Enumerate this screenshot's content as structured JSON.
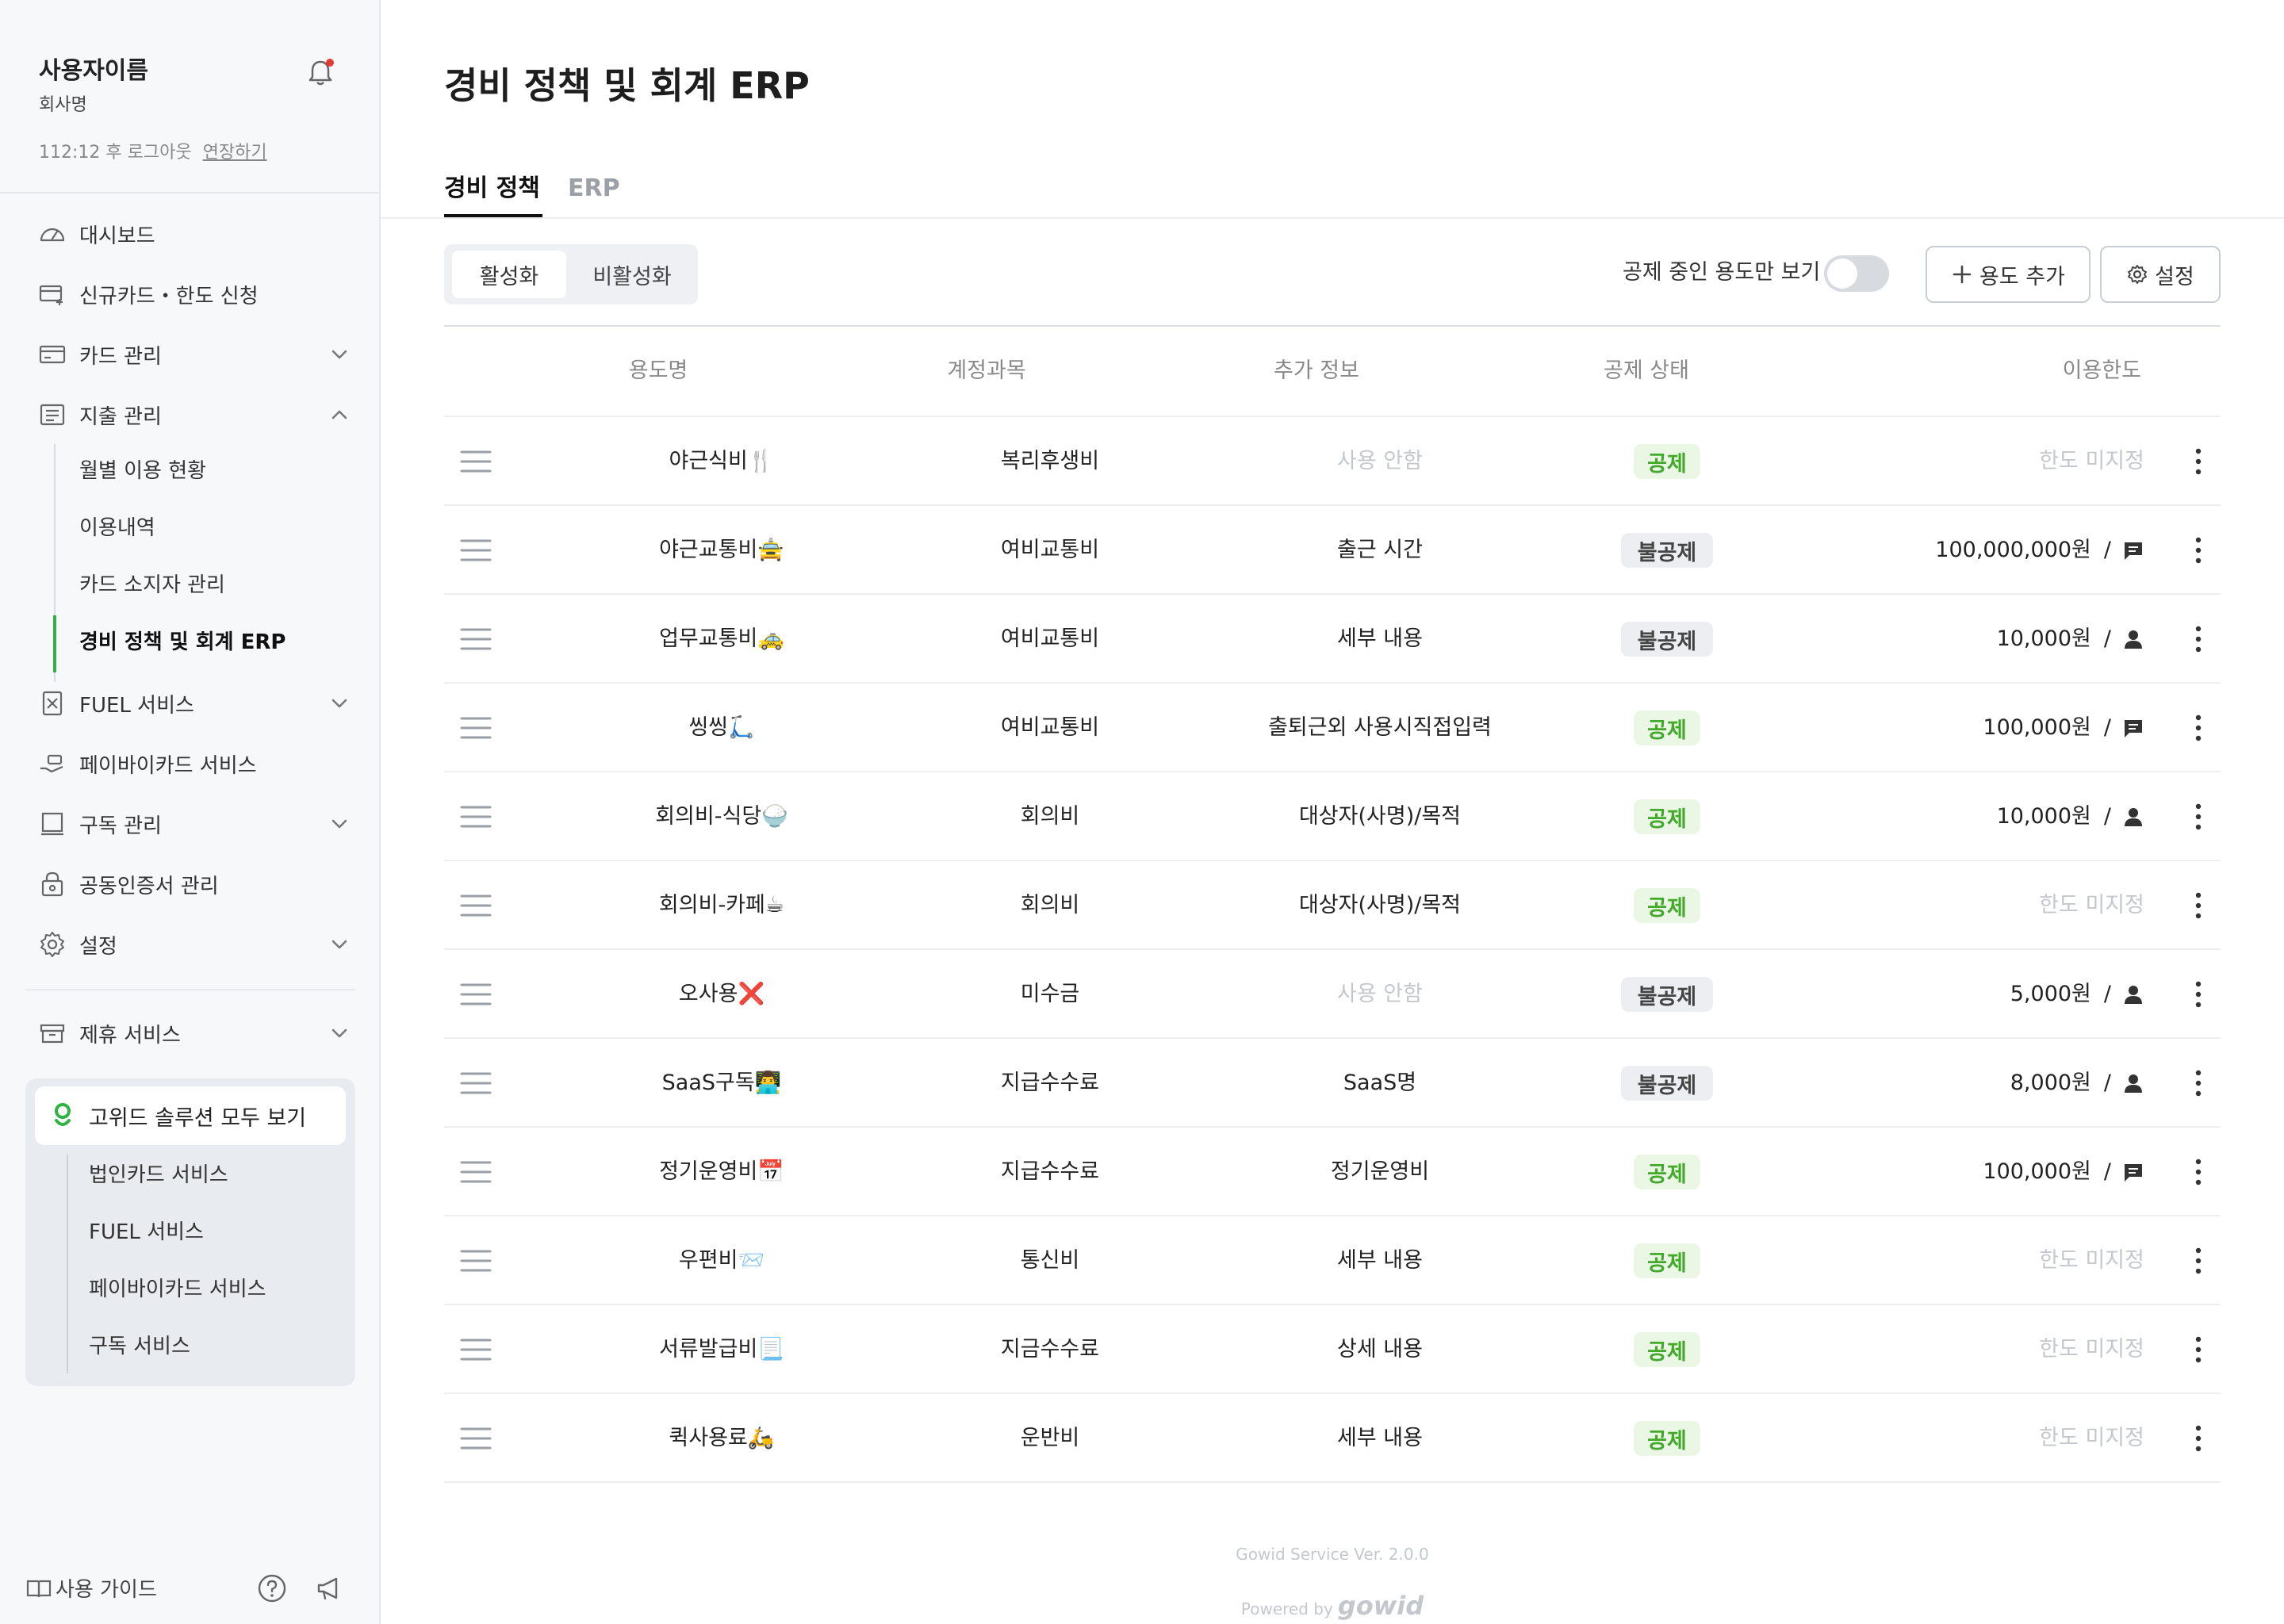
{
  "sidebar": {
    "user_name": "사용자이름",
    "company": "회사명",
    "logout_text": "112:12 후 로그아웃",
    "extend_label": "연장하기",
    "nav": [
      {
        "label": "대시보드",
        "icon": "dashboard-icon",
        "chevron": null
      },
      {
        "label": "신규카드・한도 신청",
        "icon": "card-add-icon",
        "chevron": null
      },
      {
        "label": "카드 관리",
        "icon": "card-icon",
        "chevron": "down"
      },
      {
        "label": "지출 관리",
        "icon": "receipt-icon",
        "chevron": "up"
      }
    ],
    "sub_items": [
      "월별 이용 현황",
      "이용내역",
      "카드 소지자 관리",
      "경비 정책 및 회계 ERP"
    ],
    "nav2": [
      {
        "label": "FUEL 서비스",
        "icon": "fuel-icon",
        "chevron": "down"
      },
      {
        "label": "페이바이카드 서비스",
        "icon": "hand-pay-icon",
        "chevron": null
      },
      {
        "label": "구독 관리",
        "icon": "subscription-icon",
        "chevron": "down"
      },
      {
        "label": "공동인증서 관리",
        "icon": "certificate-lock-icon",
        "chevron": null
      },
      {
        "label": "설정",
        "icon": "gear-icon",
        "chevron": "down"
      }
    ],
    "partner": {
      "label": "제휴 서비스"
    },
    "solutions_head": "고위드 솔루션 모두 보기",
    "solutions": [
      "법인카드 서비스",
      "FUEL 서비스",
      "페이바이카드 서비스",
      "구독 서비스"
    ],
    "guide_label": "사용 가이드"
  },
  "main": {
    "title": "경비 정책 및 회계 ERP",
    "tabs": [
      "경비 정책",
      "ERP"
    ],
    "segment": [
      "활성화",
      "비활성화"
    ],
    "toggle_label": "공제 중인 용도만 보기",
    "add_button": "용도 추가",
    "settings_button": "설정",
    "columns": [
      "용도명",
      "계정과목",
      "추가 정보",
      "공제 상태",
      "이용한도"
    ],
    "rows": [
      {
        "name": "야근식비🍴",
        "account": "복리후생비",
        "extra": "사용 안함",
        "extra_muted": true,
        "status": "공제",
        "deductible": true,
        "limit": "한도 미지정",
        "limit_icon": ""
      },
      {
        "name": "야근교통비🚖",
        "account": "여비교통비",
        "extra": "출근 시간",
        "extra_muted": false,
        "status": "불공제",
        "deductible": false,
        "limit": "100,000,000원",
        "limit_icon": "message-icon"
      },
      {
        "name": "업무교통비🚕",
        "account": "여비교통비",
        "extra": "세부 내용",
        "extra_muted": false,
        "status": "불공제",
        "deductible": false,
        "limit": "10,000원",
        "limit_icon": "person-icon"
      },
      {
        "name": "씽씽🛴",
        "account": "여비교통비",
        "extra": "출퇴근외 사용시직접입력",
        "extra_muted": false,
        "status": "공제",
        "deductible": true,
        "limit": "100,000원",
        "limit_icon": "message-icon"
      },
      {
        "name": "회의비-식당🍚",
        "account": "회의비",
        "extra": "대상자(사명)/목적",
        "extra_muted": false,
        "status": "공제",
        "deductible": true,
        "limit": "10,000원",
        "limit_icon": "person-icon"
      },
      {
        "name": "회의비-카페☕",
        "account": "회의비",
        "extra": "대상자(사명)/목적",
        "extra_muted": false,
        "status": "공제",
        "deductible": true,
        "limit": "한도 미지정",
        "limit_icon": ""
      },
      {
        "name": "오사용❌",
        "account": "미수금",
        "extra": "사용 안함",
        "extra_muted": true,
        "status": "불공제",
        "deductible": false,
        "limit": "5,000원",
        "limit_icon": "person-icon"
      },
      {
        "name": "SaaS구독👨‍💻",
        "account": "지급수수료",
        "extra": "SaaS명",
        "extra_muted": false,
        "status": "불공제",
        "deductible": false,
        "limit": "8,000원",
        "limit_icon": "person-icon"
      },
      {
        "name": "정기운영비📅",
        "account": "지급수수료",
        "extra": "정기운영비",
        "extra_muted": false,
        "status": "공제",
        "deductible": true,
        "limit": "100,000원",
        "limit_icon": "message-icon"
      },
      {
        "name": "우편비📨",
        "account": "통신비",
        "extra": "세부 내용",
        "extra_muted": false,
        "status": "공제",
        "deductible": true,
        "limit": "한도 미지정",
        "limit_icon": ""
      },
      {
        "name": "서류발급비📃",
        "account": "지금수수료",
        "extra": "상세 내용",
        "extra_muted": false,
        "status": "공제",
        "deductible": true,
        "limit": "한도 미지정",
        "limit_icon": ""
      },
      {
        "name": "퀵사용료🛵",
        "account": "운반비",
        "extra": "세부 내용",
        "extra_muted": false,
        "status": "공제",
        "deductible": true,
        "limit": "한도 미지정",
        "limit_icon": ""
      }
    ],
    "version": "Gowid Service Ver. 2.0.0",
    "powered_by": "Powered by",
    "brand": "gowid"
  },
  "colors": {
    "accent": "#2fb344",
    "deduct_bg": "#eaf7e4",
    "deduct_text": "#43a92a",
    "nondeduct_bg": "#eceef1",
    "notify_dot": "#e53935"
  }
}
